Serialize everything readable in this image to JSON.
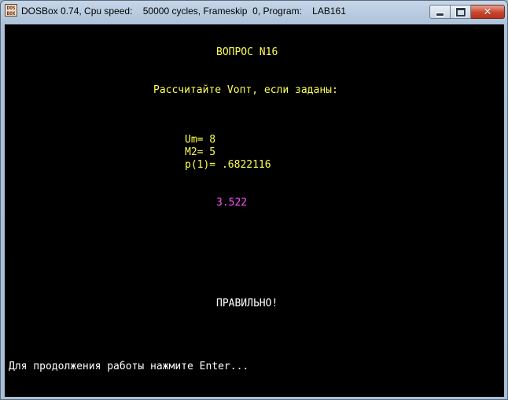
{
  "window": {
    "title": "DOSBox 0.74, Cpu speed:    50000 cycles, Frameskip  0, Program:    LAB161",
    "icon_label_top": "DOS",
    "icon_label_bottom": "BOX",
    "controls": {
      "minimize": "minimize-icon",
      "maximize": "maximize-icon",
      "close": "close-icon",
      "close_glyph": "✕"
    }
  },
  "screen": {
    "question_title": "ВОПРОС N16",
    "prompt": "Рассчитайте Vопт, если заданы:",
    "params": [
      {
        "text": "Um= 8"
      },
      {
        "text": "M2= 5"
      },
      {
        "text": "p(1)= .6822116"
      }
    ],
    "answer": "3.522",
    "verdict": "ПРАВИЛЬНО!",
    "continue_hint": "Для продолжения работы нажмите Enter..."
  },
  "colors": {
    "text_yellow": "#ffff55",
    "text_white": "#ffffff",
    "text_magenta": "#ff55ff",
    "screen_bg": "#000000"
  }
}
